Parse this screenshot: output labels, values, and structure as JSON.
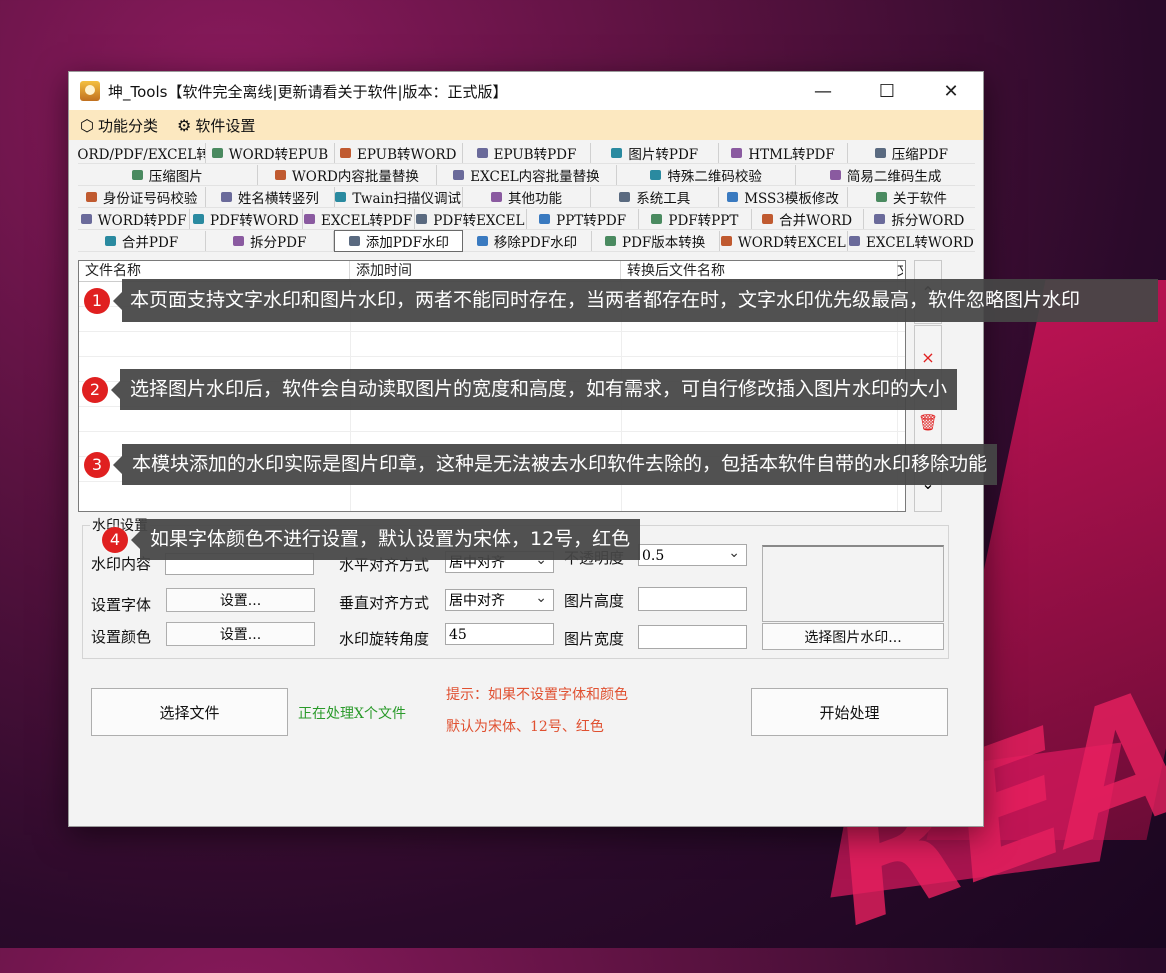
{
  "window": {
    "title": "坤_Tools【软件完全离线|更新请看关于软件|版本：正式版】",
    "minimize": "—",
    "maximize": "☐",
    "close": "✕"
  },
  "menu": [
    {
      "icon": "⬡",
      "label": "功能分类"
    },
    {
      "icon": "⚙",
      "label": "软件设置"
    }
  ],
  "tabs": [
    [
      "WORD/PDF/EXCEL转图片",
      "WORD转EPUB",
      "EPUB转WORD",
      "EPUB转PDF",
      "图片转PDF",
      "HTML转PDF",
      "压缩PDF"
    ],
    [
      "压缩图片",
      "WORD内容批量替换",
      "EXCEL内容批量替换",
      "特殊二维码校验",
      "简易二维码生成"
    ],
    [
      "身份证号码校验",
      "姓名横转竖列",
      "Twain扫描仪调试",
      "其他功能",
      "系统工具",
      "MSS3模板修改",
      "关于软件"
    ],
    [
      "WORD转PDF",
      "PDF转WORD",
      "EXCEL转PDF",
      "PDF转EXCEL",
      "PPT转PDF",
      "PDF转PPT",
      "合并WORD",
      "拆分WORD"
    ],
    [
      "合并PDF",
      "拆分PDF",
      "添加PDF水印",
      "移除PDF水印",
      "PDF版本转换",
      "WORD转EXCEL",
      "EXCEL转WORD"
    ]
  ],
  "selected_tab": "添加PDF水印",
  "file_table": {
    "columns": [
      "文件名称",
      "添加时间",
      "转换后文件名称",
      "文"
    ]
  },
  "side_buttons": [
    "⌃",
    "×",
    "🗑",
    "⌄"
  ],
  "watermark": {
    "group_title": "水印设置",
    "content_label": "水印内容",
    "content_value": "",
    "font_label": "设置字体",
    "font_button": "设置...",
    "color_label": "设置颜色",
    "color_button": "设置...",
    "halign_label": "水平对齐方式",
    "halign_value": "居中对齐",
    "valign_label": "垂直对齐方式",
    "valign_value": "居中对齐",
    "rotation_label": "水印旋转角度",
    "rotation_value": "45",
    "opacity_label": "不透明度",
    "opacity_value": "0.5",
    "img_height_label": "图片高度",
    "img_height_value": "",
    "img_width_label": "图片宽度",
    "img_width_value": "",
    "select_image_button": "选择图片水印..."
  },
  "bottom": {
    "select_file_button": "选择文件",
    "status": "正在处理X个文件",
    "hint_line1": "提示：如果不设置字体和颜色",
    "hint_line2": "默认为宋体、12号、红色",
    "start_button": "开始处理"
  },
  "callouts": [
    {
      "num": "1",
      "text": "本页面支持文字水印和图片水印，两者不能同时存在，当两者都存在时，文字水印优先级最高，软件忽略图片水印"
    },
    {
      "num": "2",
      "text": "选择图片水印后，软件会自动读取图片的宽度和高度，如有需求，可自行修改插入图片水印的大小"
    },
    {
      "num": "3",
      "text": "本模块添加的水印实际是图片印章，这种是无法被去水印软件去除的，包括本软件自带的水印移除功能"
    },
    {
      "num": "4",
      "text": "如果字体颜色不进行设置，默认设置为宋体，12号，红色"
    }
  ],
  "colors": {
    "menubar": "#fce8c0",
    "callout_number": "#e02020",
    "status_text": "#2a9a2a",
    "hint_text": "#e05030"
  }
}
